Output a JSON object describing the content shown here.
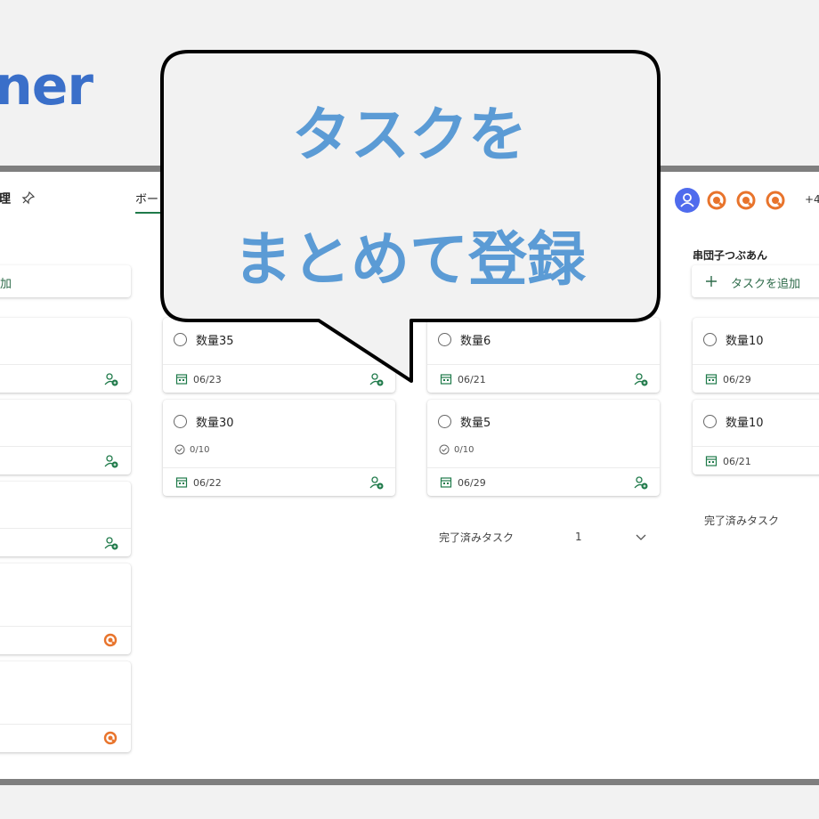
{
  "brand": {
    "text": "ner"
  },
  "header": {
    "plan_title": "理",
    "tab_board": "ボード",
    "more_members": "+4"
  },
  "bubble": {
    "line1": "タスクを",
    "line2": "まとめて登録"
  },
  "columns": {
    "left": {
      "add_label": "加"
    },
    "c1": {
      "cards": [
        {
          "name": "数量35",
          "date": "06/23"
        },
        {
          "name": "数量30",
          "checklist": "0/10",
          "date": "06/22"
        }
      ]
    },
    "c2": {
      "cards": [
        {
          "name": "数量6",
          "date": "06/21"
        },
        {
          "name": "数量5",
          "checklist": "0/10",
          "date": "06/29"
        }
      ],
      "completed_label": "完了済みタスク",
      "completed_count": "1"
    },
    "c3": {
      "bucket_name": "串団子つぶあん",
      "add_label": "タスクを追加",
      "cards": [
        {
          "name": "数量10",
          "date": "06/29"
        },
        {
          "name": "数量10",
          "date": "06/21"
        }
      ],
      "completed_label": "完了済みタスク"
    }
  },
  "colors": {
    "brand": "#3a6fc9",
    "bubble_text": "#5b9bd5",
    "accent_green": "#1f7a4a",
    "avatar_orange": "#e8742c",
    "avatar_blue": "#4f6bed"
  }
}
